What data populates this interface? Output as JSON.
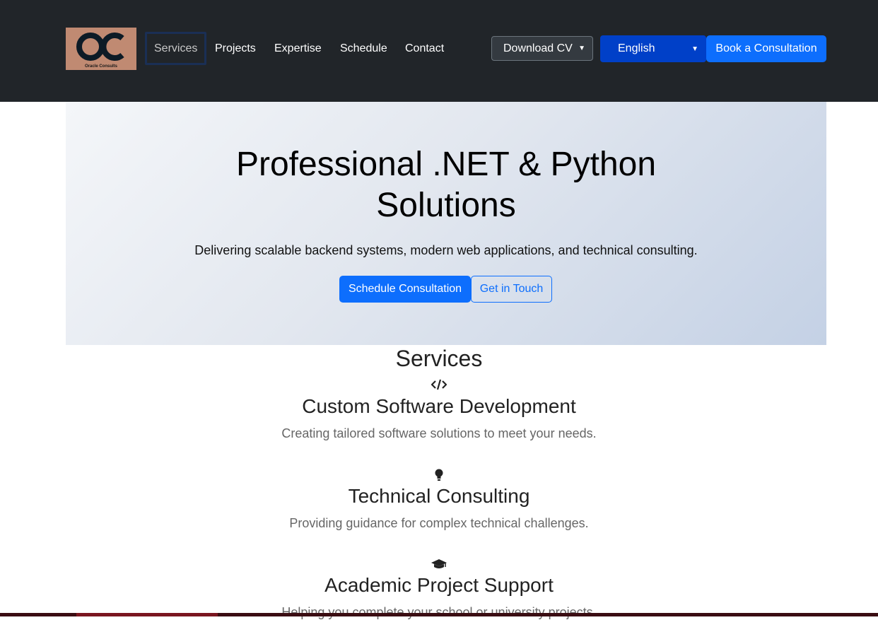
{
  "brand": {
    "logo_text": "OC",
    "logo_caption": "Oracle Consults"
  },
  "nav": {
    "items": [
      {
        "label": "Services"
      },
      {
        "label": "Projects"
      },
      {
        "label": "Expertise"
      },
      {
        "label": "Schedule"
      },
      {
        "label": "Contact"
      }
    ],
    "cv_select": "Download CV",
    "language_select": "English",
    "book_button": "Book a Consultation"
  },
  "hero": {
    "title_line1": "Professional .NET & Python",
    "title_line2": "Solutions",
    "subtitle": "Delivering scalable backend systems, modern web applications, and technical consulting.",
    "primary_button": "Schedule Consultation",
    "secondary_button": "Get in Touch"
  },
  "services": {
    "title": "Services",
    "items": [
      {
        "icon": "code-icon",
        "title": "Custom Software Development",
        "description": "Creating tailored software solutions to meet your needs."
      },
      {
        "icon": "lightbulb-icon",
        "title": "Technical Consulting",
        "description": "Providing guidance for complex technical challenges."
      },
      {
        "icon": "graduation-cap-icon",
        "title": "Academic Project Support",
        "description": "Helping you complete your school or university projects."
      }
    ]
  },
  "colors": {
    "navbar_bg": "#212529",
    "accent_blue": "#0d6efd",
    "language_select_bg": "#0040c8",
    "hero_gradient_end": "#c4d1e5"
  }
}
